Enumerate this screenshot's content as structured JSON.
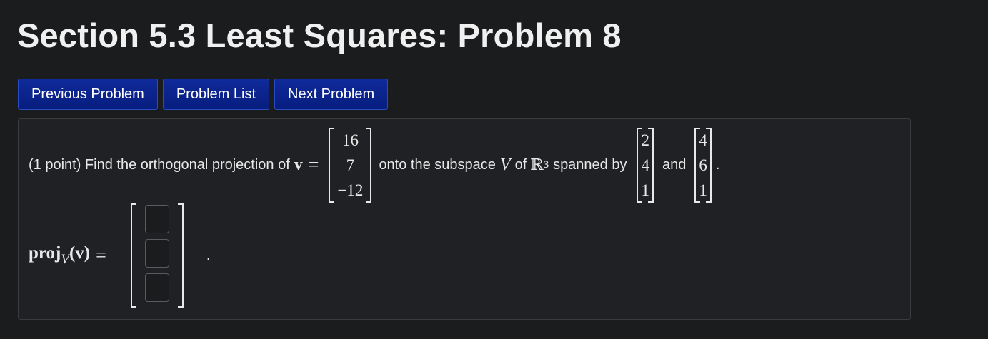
{
  "page": {
    "title": "Section 5.3 Least Squares: Problem 8"
  },
  "nav": {
    "previous": "Previous Problem",
    "list": "Problem List",
    "next": "Next Problem"
  },
  "problem": {
    "intro": "(1 point) Find the orthogonal projection of",
    "vector_symbol": "v",
    "equals": "=",
    "v_entries": [
      "16",
      "7",
      "−12"
    ],
    "onto_text": "onto the subspace",
    "subspace_symbol": "V",
    "of_text": "of",
    "space_symbol": "ℝ",
    "space_dim": "3",
    "spanned_text": "spanned by",
    "basis1": [
      "2",
      "4",
      "1"
    ],
    "and_text": "and",
    "basis2": [
      "4",
      "6",
      "1"
    ],
    "end_period": "."
  },
  "answer": {
    "label_proj": "proj",
    "label_sub": "V",
    "label_arg": "(v)",
    "equals": "=",
    "inputs": [
      "",
      "",
      ""
    ],
    "end_period": "."
  }
}
